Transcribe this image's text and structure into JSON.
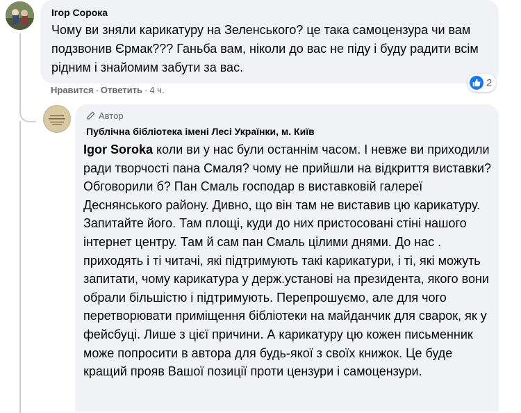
{
  "comment": {
    "author": "Ігор Сорока",
    "text": "Чому ви зняли карикатуру на Зеленського? це така самоцензура чи вам подзвонив Єрмак??? Ганьба вам, ніколи до вас не піду і буду радити всім рідним і знайомим забути за вас.",
    "actions": {
      "like_label": "Нравится",
      "reply_label": "Ответить",
      "separator": "·",
      "time": "4 ч."
    },
    "reactions": {
      "icon": "like-icon",
      "count": "2",
      "color": "#1877f2"
    }
  },
  "reply": {
    "badge_label": "Автор",
    "badge_icon": "pencil-icon",
    "author": "Публічна бібліотека імені Лесі Українки, м. Київ",
    "mention": "Igor Soroka",
    "text": " коли ви у нас були останнім часом. І невже ви приходили ради творчості пана Смаля? чому не прийшли на відкриття виставки? Обговорили б? Пан Смаль господар в виставковій галереї Деснянського району. Дивно, що він там не виставив цю карикатуру. Запитайте його. Там площі, куди до них пристосовані стіні нашого інтернет центру. Там й сам пан Смаль цілими днями. До нас . приходять і ті читачі, які підтримують такі карикатури, і ті, які можуть запитати, чому карикатура у держ.установі на президента, якого вони обрали більшістю і підтримують. Перепрошуємо, але для чого перетворювати приміщення бібліотеки на майданчик для сварок, як у фейсбуці. Лише з цієї причини. А карикатуру цю кожен письменник може попросити в автора для будь-якої з своїх книжок. Це буде кращий прояв Вашої позиції проти цензури і самоцензури."
  }
}
